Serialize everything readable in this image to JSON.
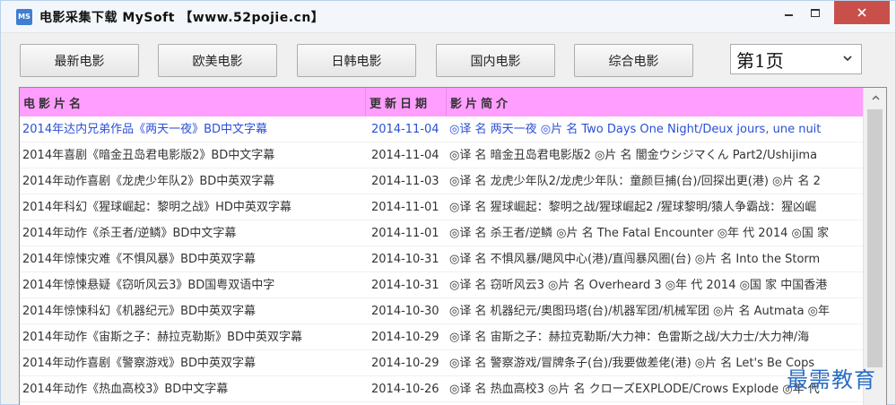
{
  "window": {
    "app_icon_text": "MS",
    "title": "电影采集下载   MySoft   【www.52pojie.cn】"
  },
  "toolbar": {
    "buttons": [
      {
        "label": "最新电影"
      },
      {
        "label": "欧美电影"
      },
      {
        "label": "日韩电影"
      },
      {
        "label": "国内电影"
      },
      {
        "label": "综合电影"
      }
    ],
    "page_select": {
      "value": "第1页"
    }
  },
  "table": {
    "headers": {
      "title": "电影片名",
      "date": "更新日期",
      "intro": "影片简介"
    },
    "rows": [
      {
        "title": "2014年达内兄弟作品《两天一夜》BD中文字幕",
        "date": "2014-11-04",
        "intro": "◎译 名 两天一夜 ◎片 名 Two Days One Night/Deux jours, une nuit"
      },
      {
        "title": "2014年喜剧《暗金丑岛君电影版2》BD中文字幕",
        "date": "2014-11-04",
        "intro": "◎译 名 暗金丑岛君电影版2 ◎片 名 闇金ウシジマくん Part2/Ushijima"
      },
      {
        "title": "2014年动作喜剧《龙虎少年队2》BD中英双字幕",
        "date": "2014-11-03",
        "intro": "◎译 名 龙虎少年队2/龙虎少年队：童颜巨捕(台)/回探出更(港) ◎片 名 2"
      },
      {
        "title": "2014年科幻《猩球崛起：黎明之战》HD中英双字幕",
        "date": "2014-11-01",
        "intro": "◎译 名 猩球崛起：黎明之战/猩球崛起2 /猩球黎明/猿人争霸战：猩凶崛"
      },
      {
        "title": "2014年动作《杀王者/逆鳞》BD中文字幕",
        "date": "2014-11-01",
        "intro": "◎译 名 杀王者/逆鳞 ◎片 名 The Fatal Encounter ◎年 代 2014 ◎国 家"
      },
      {
        "title": "2014年惊悚灾难《不惧风暴》BD中英双字幕",
        "date": "2014-10-31",
        "intro": "◎译 名 不惧风暴/飓风中心(港)/直闯暴风圈(台) ◎片 名 Into the Storm"
      },
      {
        "title": "2014年惊悚悬疑《窃听风云3》BD国粤双语中字",
        "date": "2014-10-31",
        "intro": "◎译 名 窃听风云3 ◎片 名 Overheard 3 ◎年 代 2014 ◎国 家 中国香港"
      },
      {
        "title": "2014年惊悚科幻《机器纪元》BD中英双字幕",
        "date": "2014-10-30",
        "intro": "◎译 名 机器纪元/奥图玛塔(台)/机器军团/机械军团 ◎片 名 Autmata ◎年"
      },
      {
        "title": "2014年动作《宙斯之子：赫拉克勒斯》BD中英双字幕",
        "date": "2014-10-29",
        "intro": "◎译 名 宙斯之子：赫拉克勒斯/大力神：色雷斯之战/大力士/大力神/海"
      },
      {
        "title": "2014年动作喜剧《警察游戏》BD中英双字幕",
        "date": "2014-10-29",
        "intro": "◎译 名 警察游戏/冒牌条子(台)/我要做差佬(港) ◎片 名 Let's Be Cops"
      },
      {
        "title": "2014年动作《热血高校3》BD中文字幕",
        "date": "2014-10-26",
        "intro": "◎译 名 热血高校3 ◎片 名 クローズEXPLODE/Crows Explode ◎年 代"
      }
    ]
  },
  "watermark": {
    "text": "最需教育"
  }
}
